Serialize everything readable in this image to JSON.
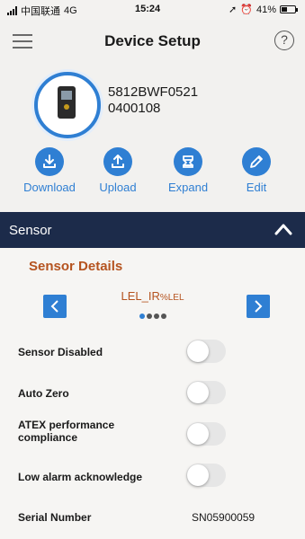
{
  "status_bar": {
    "carrier": "中国联通",
    "network": "4G",
    "time": "15:24",
    "battery": "41%",
    "battery_level": 0.41
  },
  "header": {
    "title": "Device Setup",
    "menu_icon": "hamburger-menu-icon",
    "help_icon": "help-icon",
    "help_glyph": "?"
  },
  "device": {
    "id_line1": "5812BWF0521",
    "id_line2": "0400108"
  },
  "actions": [
    {
      "label": "Download",
      "icon": "download-icon"
    },
    {
      "label": "Upload",
      "icon": "upload-icon"
    },
    {
      "label": "Expand",
      "icon": "expand-icon"
    },
    {
      "label": "Edit",
      "icon": "pencil-icon"
    }
  ],
  "section": {
    "label": "Sensor",
    "expanded": true
  },
  "sensor_details": {
    "title": "Sensor Details",
    "sensor_name": "LEL_IR",
    "sensor_unit": "%LEL",
    "page_count": 4,
    "active_page": 0
  },
  "settings": [
    {
      "label": "Sensor Disabled",
      "enabled": false
    },
    {
      "label": "Auto Zero",
      "enabled": false
    },
    {
      "label": "ATEX performance compliance",
      "enabled": false
    },
    {
      "label": "Low alarm acknowledge",
      "enabled": false
    }
  ],
  "serial": {
    "label": "Serial Number",
    "value": "SN05900059"
  },
  "colors": {
    "accent": "#2f7fd3",
    "section_bar": "#1c2b4a",
    "details_title": "#b5531f"
  }
}
